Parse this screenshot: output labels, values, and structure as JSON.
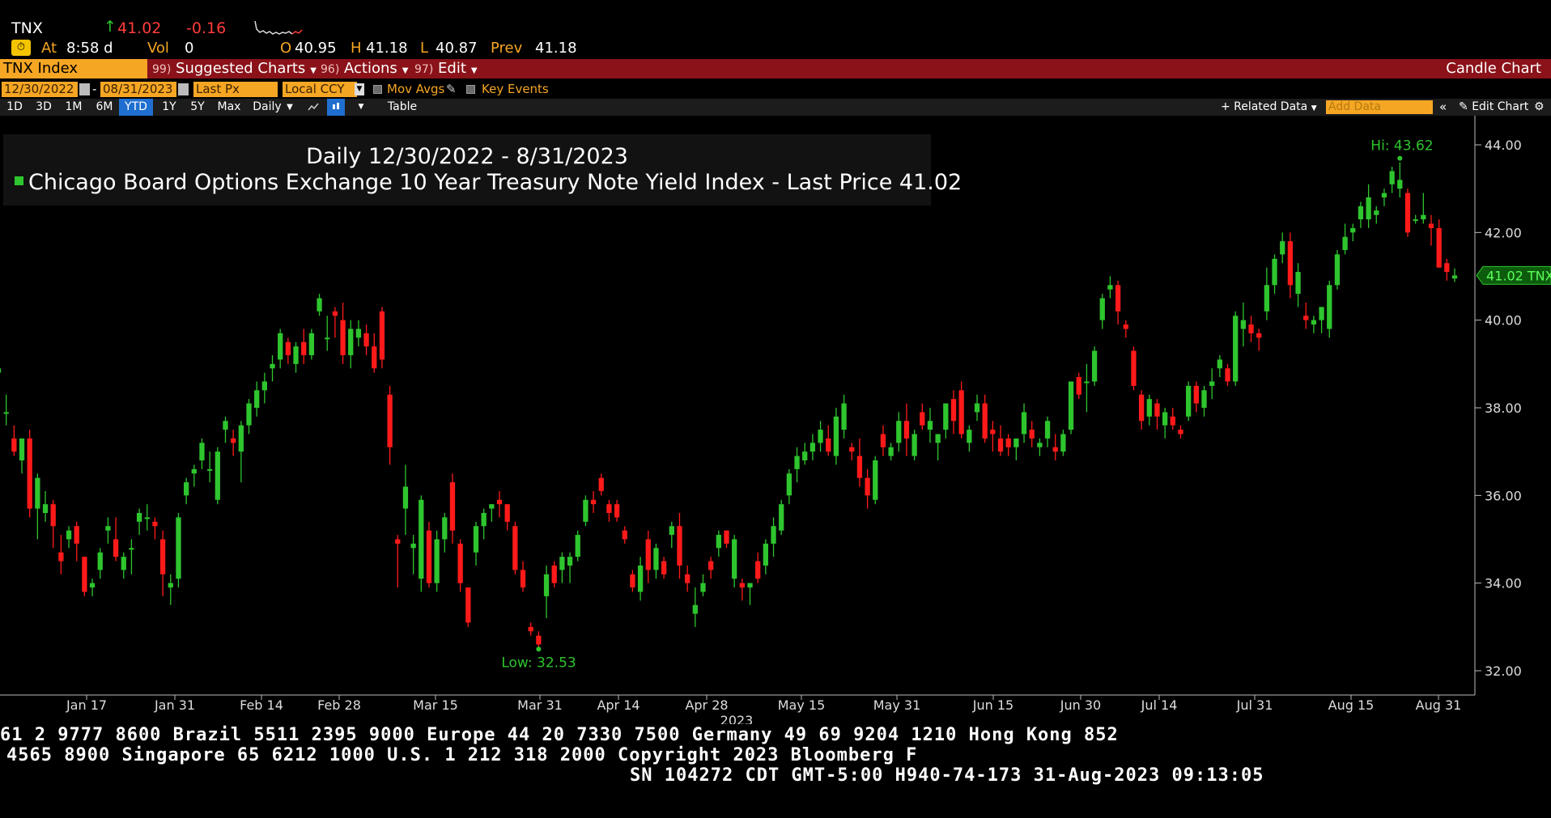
{
  "header": {
    "ticker": "TNX",
    "arrow": "↑",
    "last": "41.02",
    "change": "-0.16",
    "at_label": "At",
    "time": "8:58 d",
    "vol_label": "Vol",
    "vol": "0",
    "open_label": "O",
    "open": "40.95",
    "high_label": "H",
    "high": "41.18",
    "low_label": "L",
    "low": "40.87",
    "prev_label": "Prev",
    "prev": "41.18"
  },
  "toolbar": {
    "security": "TNX Index",
    "menus": [
      {
        "num": "99)",
        "label": "Suggested Charts"
      },
      {
        "num": "96)",
        "label": "Actions"
      },
      {
        "num": "97)",
        "label": "Edit"
      }
    ],
    "chart_type": "Candle Chart"
  },
  "settings": {
    "start_date": "12/30/2022",
    "dash": "-",
    "end_date": "08/31/2023",
    "price_field": "Last Px",
    "currency": "Local CCY",
    "mov_avgs": "Mov Avgs",
    "key_events": "Key Events"
  },
  "range": {
    "buttons": [
      "1D",
      "3D",
      "1M",
      "6M",
      "YTD",
      "1Y",
      "5Y",
      "Max"
    ],
    "selected": "YTD",
    "period": "Daily",
    "table": "Table",
    "related_data": "+ Related Data",
    "add_data_placeholder": "Add Data",
    "edit_chart": "Edit Chart"
  },
  "legend": {
    "title": "Daily 12/30/2022 - 8/31/2023",
    "series": "Chicago Board Options Exchange 10 Year Treasury Note Yield Index - Last Price",
    "series_value": "41.02"
  },
  "chart_data": {
    "type": "candlestick",
    "ylim": [
      31.5,
      44.5
    ],
    "y_ticks": [
      "44.00",
      "42.00",
      "40.00",
      "38.00",
      "36.00",
      "34.00",
      "32.00"
    ],
    "x_ticks": [
      "Jan 17",
      "Jan 31",
      "Feb 14",
      "Feb 28",
      "Mar 15",
      "Mar 31",
      "Apr 14",
      "Apr 28",
      "May 15",
      "May 31",
      "Jun 15",
      "Jun 30",
      "Jul 14",
      "Jul 31",
      "Aug 15",
      "Aug 31"
    ],
    "x_year_label": "2023",
    "annotations": {
      "high": "Hi: 43.62",
      "low": "Low: 32.53",
      "last": "41.02 TNX"
    },
    "last_price": 41.02,
    "high_value": 43.62,
    "low_value": 32.53,
    "colors": {
      "up": "#2ec52e",
      "down": "#ff1a1a"
    },
    "ohlc": [
      [
        38.8,
        39.2,
        38.6,
        38.9
      ],
      [
        37.9,
        38.3,
        37.6,
        37.9
      ],
      [
        37.3,
        37.6,
        36.9,
        37.0
      ],
      [
        36.8,
        37.2,
        36.5,
        37.3
      ],
      [
        37.3,
        37.5,
        35.5,
        35.7
      ],
      [
        35.7,
        36.5,
        35.0,
        36.4
      ],
      [
        35.6,
        36.1,
        35.4,
        35.8
      ],
      [
        35.8,
        35.9,
        34.8,
        35.3
      ],
      [
        34.7,
        35.1,
        34.2,
        34.5
      ],
      [
        35.0,
        35.3,
        34.8,
        35.2
      ],
      [
        35.3,
        35.4,
        34.5,
        34.9
      ],
      [
        34.6,
        34.6,
        33.7,
        33.8
      ],
      [
        33.9,
        34.1,
        33.7,
        34.0
      ],
      [
        34.3,
        34.8,
        34.1,
        34.7
      ],
      [
        35.2,
        35.5,
        34.9,
        35.3
      ],
      [
        35.0,
        35.5,
        34.5,
        34.6
      ],
      [
        34.3,
        34.7,
        34.1,
        34.6
      ],
      [
        34.8,
        35.0,
        34.2,
        34.8
      ],
      [
        35.4,
        35.7,
        35.1,
        35.6
      ],
      [
        35.5,
        35.8,
        35.2,
        35.5
      ],
      [
        35.4,
        35.5,
        35.0,
        35.3
      ],
      [
        35.0,
        35.2,
        33.7,
        34.2
      ],
      [
        33.9,
        34.2,
        33.5,
        34.0
      ],
      [
        34.1,
        35.6,
        33.9,
        35.5
      ],
      [
        36.0,
        36.4,
        35.8,
        36.3
      ],
      [
        36.5,
        36.7,
        36.2,
        36.6
      ],
      [
        36.8,
        37.3,
        36.6,
        37.2
      ],
      [
        36.6,
        37.0,
        36.3,
        36.6
      ],
      [
        35.9,
        37.1,
        35.8,
        37.0
      ],
      [
        37.5,
        37.8,
        37.2,
        37.7
      ],
      [
        37.3,
        37.5,
        36.9,
        37.2
      ],
      [
        37.0,
        37.7,
        36.3,
        37.6
      ],
      [
        37.6,
        38.2,
        37.4,
        38.1
      ],
      [
        38.0,
        38.6,
        37.8,
        38.4
      ],
      [
        38.4,
        38.8,
        38.1,
        38.6
      ],
      [
        38.9,
        39.2,
        38.6,
        39.0
      ],
      [
        39.1,
        39.8,
        38.9,
        39.7
      ],
      [
        39.5,
        39.6,
        39.0,
        39.2
      ],
      [
        39.0,
        39.5,
        38.8,
        39.4
      ],
      [
        39.5,
        39.8,
        39.0,
        39.2
      ],
      [
        39.2,
        39.8,
        39.1,
        39.7
      ],
      [
        40.2,
        40.6,
        40.1,
        40.5
      ],
      [
        39.6,
        40.1,
        39.3,
        39.6
      ],
      [
        40.2,
        40.3,
        39.6,
        40.1
      ],
      [
        40.0,
        40.4,
        39.0,
        39.2
      ],
      [
        39.2,
        40.0,
        38.9,
        39.8
      ],
      [
        39.6,
        40.0,
        39.4,
        39.8
      ],
      [
        39.7,
        39.9,
        39.2,
        39.4
      ],
      [
        39.4,
        39.7,
        38.8,
        38.9
      ],
      [
        40.2,
        40.3,
        38.9,
        39.1
      ],
      [
        38.3,
        38.5,
        36.7,
        37.1
      ],
      [
        35.0,
        35.1,
        33.9,
        34.9
      ],
      [
        35.7,
        36.7,
        35.1,
        36.2
      ],
      [
        34.8,
        35.1,
        34.2,
        34.9
      ],
      [
        34.1,
        36.0,
        33.8,
        35.9
      ],
      [
        35.2,
        35.4,
        33.9,
        34.0
      ],
      [
        34.0,
        35.2,
        33.8,
        35.0
      ],
      [
        35.0,
        35.6,
        34.7,
        35.5
      ],
      [
        36.3,
        36.5,
        34.9,
        35.2
      ],
      [
        34.9,
        35.0,
        33.8,
        34.0
      ],
      [
        33.9,
        33.9,
        33.0,
        33.1
      ],
      [
        34.7,
        35.4,
        34.4,
        35.3
      ],
      [
        35.3,
        35.7,
        35.0,
        35.6
      ],
      [
        35.7,
        35.8,
        35.4,
        35.8
      ],
      [
        35.9,
        36.1,
        35.5,
        35.8
      ],
      [
        35.8,
        35.8,
        35.2,
        35.4
      ],
      [
        35.3,
        35.4,
        34.2,
        34.3
      ],
      [
        34.3,
        34.5,
        33.8,
        33.9
      ],
      [
        33.0,
        33.1,
        32.8,
        32.9
      ],
      [
        32.8,
        32.9,
        32.5,
        32.6
      ],
      [
        33.7,
        34.4,
        33.2,
        34.2
      ],
      [
        34.4,
        34.5,
        33.9,
        34.0
      ],
      [
        34.3,
        34.7,
        34.0,
        34.6
      ],
      [
        34.4,
        34.7,
        34.0,
        34.6
      ],
      [
        34.6,
        35.2,
        34.5,
        35.1
      ],
      [
        35.4,
        36.0,
        35.3,
        35.9
      ],
      [
        35.9,
        36.1,
        35.6,
        35.8
      ],
      [
        36.4,
        36.5,
        36.0,
        36.1
      ],
      [
        35.8,
        35.9,
        35.4,
        35.6
      ],
      [
        35.8,
        35.9,
        35.4,
        35.5
      ],
      [
        35.2,
        35.3,
        34.9,
        35.0
      ],
      [
        34.2,
        34.3,
        33.8,
        33.9
      ],
      [
        33.8,
        34.6,
        33.6,
        34.4
      ],
      [
        35.0,
        35.2,
        34.0,
        34.3
      ],
      [
        34.3,
        34.9,
        34.1,
        34.8
      ],
      [
        34.5,
        34.6,
        34.1,
        34.2
      ],
      [
        35.1,
        35.4,
        34.8,
        35.3
      ],
      [
        35.3,
        35.6,
        34.1,
        34.4
      ],
      [
        34.2,
        34.4,
        33.8,
        34.0
      ],
      [
        33.3,
        33.9,
        33.0,
        33.5
      ],
      [
        33.8,
        34.2,
        33.7,
        34.0
      ],
      [
        34.5,
        34.6,
        34.1,
        34.3
      ],
      [
        34.8,
        35.2,
        34.6,
        35.1
      ],
      [
        35.2,
        35.2,
        34.8,
        34.9
      ],
      [
        34.1,
        35.1,
        33.9,
        35.0
      ],
      [
        34.0,
        34.1,
        33.6,
        33.9
      ],
      [
        33.9,
        34.0,
        33.5,
        34.0
      ],
      [
        34.5,
        34.7,
        34.0,
        34.1
      ],
      [
        34.4,
        35.0,
        34.2,
        34.9
      ],
      [
        34.9,
        35.5,
        34.6,
        35.3
      ],
      [
        35.2,
        35.9,
        35.1,
        35.8
      ],
      [
        36.0,
        36.6,
        35.8,
        36.5
      ],
      [
        36.6,
        37.1,
        36.3,
        36.9
      ],
      [
        36.8,
        37.2,
        36.7,
        37.0
      ],
      [
        37.0,
        37.4,
        36.8,
        37.2
      ],
      [
        37.2,
        37.7,
        37.0,
        37.5
      ],
      [
        37.3,
        37.6,
        36.9,
        37.0
      ],
      [
        36.9,
        38.0,
        36.7,
        37.8
      ],
      [
        37.5,
        38.3,
        37.3,
        38.1
      ],
      [
        37.1,
        37.2,
        36.8,
        37.0
      ],
      [
        36.9,
        37.3,
        36.2,
        36.4
      ],
      [
        36.4,
        36.6,
        35.7,
        36.0
      ],
      [
        35.9,
        36.9,
        35.8,
        36.8
      ],
      [
        37.4,
        37.6,
        36.9,
        37.1
      ],
      [
        36.9,
        37.2,
        36.8,
        37.1
      ],
      [
        37.2,
        37.9,
        37.0,
        37.7
      ],
      [
        37.7,
        38.1,
        36.9,
        37.3
      ],
      [
        36.9,
        37.5,
        36.8,
        37.4
      ],
      [
        37.9,
        38.1,
        37.5,
        37.6
      ],
      [
        37.5,
        38.0,
        37.2,
        37.7
      ],
      [
        37.2,
        37.4,
        36.8,
        37.4
      ],
      [
        37.5,
        38.1,
        37.3,
        38.1
      ],
      [
        38.2,
        38.4,
        37.4,
        37.7
      ],
      [
        38.4,
        38.6,
        37.3,
        37.4
      ],
      [
        37.2,
        37.6,
        37.0,
        37.5
      ],
      [
        37.9,
        38.3,
        37.7,
        38.1
      ],
      [
        38.1,
        38.3,
        37.2,
        37.3
      ],
      [
        37.5,
        37.7,
        37.0,
        37.4
      ],
      [
        37.3,
        37.6,
        36.9,
        37.0
      ],
      [
        37.3,
        37.4,
        36.9,
        37.1
      ],
      [
        37.1,
        37.3,
        36.8,
        37.3
      ],
      [
        37.4,
        38.1,
        37.2,
        37.9
      ],
      [
        37.5,
        37.7,
        37.1,
        37.3
      ],
      [
        37.1,
        37.3,
        36.9,
        37.2
      ],
      [
        37.3,
        37.8,
        37.1,
        37.7
      ],
      [
        37.1,
        37.4,
        36.8,
        37.0
      ],
      [
        37.0,
        37.5,
        36.9,
        37.4
      ],
      [
        37.5,
        38.6,
        37.4,
        38.6
      ],
      [
        38.7,
        38.8,
        38.2,
        38.3
      ],
      [
        38.6,
        39.0,
        37.9,
        38.6
      ],
      [
        38.6,
        39.4,
        38.5,
        39.3
      ],
      [
        40.0,
        40.6,
        39.8,
        40.5
      ],
      [
        40.7,
        41.0,
        40.5,
        40.8
      ],
      [
        40.8,
        40.9,
        39.9,
        40.2
      ],
      [
        39.9,
        40.0,
        39.6,
        39.8
      ],
      [
        39.3,
        39.4,
        38.4,
        38.5
      ],
      [
        38.3,
        38.4,
        37.5,
        37.7
      ],
      [
        37.8,
        38.3,
        37.6,
        38.2
      ],
      [
        38.1,
        38.2,
        37.5,
        37.8
      ],
      [
        37.6,
        38.0,
        37.3,
        37.9
      ],
      [
        37.8,
        38.0,
        37.5,
        37.6
      ],
      [
        37.5,
        37.6,
        37.3,
        37.4
      ],
      [
        37.8,
        38.6,
        37.7,
        38.5
      ],
      [
        38.5,
        38.6,
        37.9,
        38.1
      ],
      [
        38.0,
        38.5,
        37.8,
        38.4
      ],
      [
        38.5,
        38.9,
        38.2,
        38.6
      ],
      [
        38.9,
        39.2,
        38.7,
        39.1
      ],
      [
        38.9,
        39.0,
        38.5,
        38.6
      ],
      [
        38.6,
        40.2,
        38.5,
        40.1
      ],
      [
        39.8,
        40.4,
        39.4,
        40.0
      ],
      [
        39.9,
        40.1,
        39.5,
        39.7
      ],
      [
        39.7,
        39.8,
        39.3,
        39.6
      ],
      [
        40.2,
        41.2,
        40.0,
        40.8
      ],
      [
        40.8,
        41.5,
        40.6,
        41.4
      ],
      [
        41.5,
        42.0,
        41.3,
        41.8
      ],
      [
        41.8,
        42.0,
        40.5,
        40.8
      ],
      [
        40.6,
        41.3,
        40.3,
        41.1
      ],
      [
        40.1,
        40.4,
        39.8,
        40.0
      ],
      [
        39.9,
        40.1,
        39.7,
        40.0
      ],
      [
        40.0,
        40.3,
        39.7,
        40.3
      ],
      [
        39.8,
        40.9,
        39.6,
        40.8
      ],
      [
        40.8,
        41.6,
        40.7,
        41.5
      ],
      [
        41.6,
        42.2,
        41.5,
        41.9
      ],
      [
        42.0,
        42.2,
        41.8,
        42.1
      ],
      [
        42.3,
        42.7,
        42.1,
        42.6
      ],
      [
        42.3,
        43.1,
        42.1,
        42.8
      ],
      [
        42.4,
        42.6,
        42.2,
        42.5
      ],
      [
        42.8,
        43.0,
        42.6,
        42.9
      ],
      [
        43.1,
        43.5,
        42.9,
        43.4
      ],
      [
        43.0,
        43.6,
        42.8,
        43.2
      ],
      [
        42.9,
        43.0,
        41.9,
        42.0
      ],
      [
        42.3,
        42.4,
        42.2,
        42.3
      ],
      [
        42.3,
        42.9,
        42.2,
        42.4
      ],
      [
        42.2,
        42.4,
        41.7,
        42.1
      ],
      [
        42.1,
        42.3,
        41.2,
        41.2
      ],
      [
        41.3,
        41.4,
        40.9,
        41.1
      ],
      [
        40.95,
        41.18,
        40.87,
        41.02
      ]
    ]
  },
  "footer": {
    "line1": "61 2 9777 8600 Brazil 5511 2395 9000 Europe 44 20 7330 7500 Germany 49 69 9204 1210 Hong Kong 852",
    "line2": "4565 8900       Singapore 65 6212 1000       U.S. 1 212 318 2000        Copyright 2023 Bloomberg F",
    "line3": "SN 104272 CDT  GMT-5:00 H940-74-173 31-Aug-2023 09:13:05"
  }
}
